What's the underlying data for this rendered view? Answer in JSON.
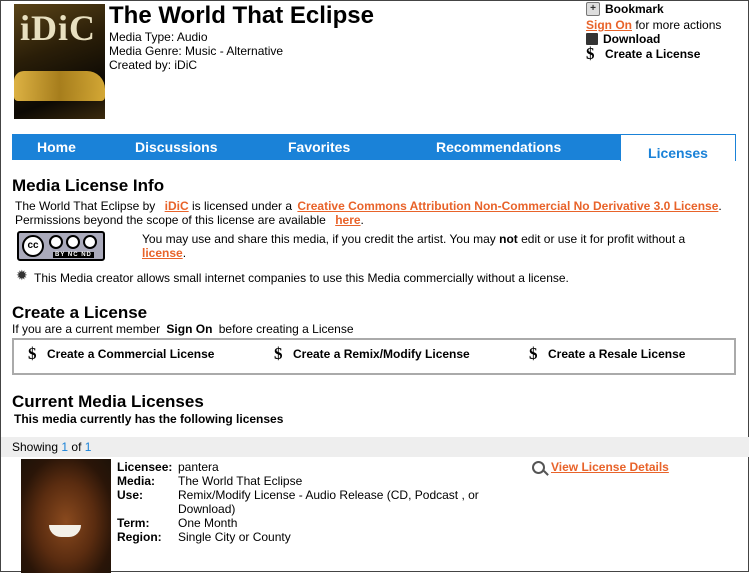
{
  "media": {
    "cover_logo": "iDiC",
    "title": "The World That Eclipse",
    "type_line": "Media Type: Audio",
    "genre_line": "Media Genre: Music - Alternative",
    "creator_line": "Created by: iDiC"
  },
  "actions": {
    "bookmark": "Bookmark",
    "sign_on": "Sign On",
    "sign_on_suffix": "for more actions",
    "download": "Download",
    "create_license": "Create a License"
  },
  "nav": {
    "tabs": [
      "Home",
      "Discussions",
      "Favorites",
      "Recommendations"
    ],
    "active": "Licenses"
  },
  "info": {
    "heading": "Media License Info",
    "line1_a": "The World That Eclipse by",
    "creator_link": "iDiC",
    "line1_b": "is licensed under a",
    "license_link": "Creative Commons Attribution Non-Commercial No Derivative 3.0 License",
    "line1_c": ".",
    "line2": "Permissions beyond the scope of this license are available",
    "here_link": "here",
    "badge_text": "BY NC ND",
    "desc_a": "You may use and share this media, if you credit the artist. You may",
    "desc_bold": "not",
    "desc_b": "edit or use it for profit without a",
    "license_word": "license",
    "commercial_note": "This Media creator allows small internet companies to use this Media commercially without a license."
  },
  "create": {
    "heading": "Create a License",
    "prompt_a": "If you are a current member",
    "prompt_sign_on": "Sign On",
    "prompt_b": "before creating a License",
    "buttons": [
      "Create a Commercial License",
      "Create a Remix/Modify License",
      "Create a Resale License"
    ]
  },
  "current": {
    "heading": "Current Media Licenses",
    "subheading": "This media currently has the following licenses",
    "showing_label": "Showing",
    "showing_current": "1",
    "showing_of": "of",
    "showing_total": "1",
    "view_details": "View License Details",
    "labels": {
      "licensee": "Licensee:",
      "media": "Media:",
      "use": "Use:",
      "term": "Term:",
      "region": "Region:"
    },
    "record": {
      "licensee": "pantera",
      "media": "The World That Eclipse",
      "use_1": "Remix/Modify License - Audio Release (CD, Podcast , or",
      "use_2": "Download)",
      "term": "One Month",
      "region": "Single City or County"
    }
  },
  "colors": {
    "nav_blue": "#1a82d8",
    "link_orange": "#e8632a"
  }
}
